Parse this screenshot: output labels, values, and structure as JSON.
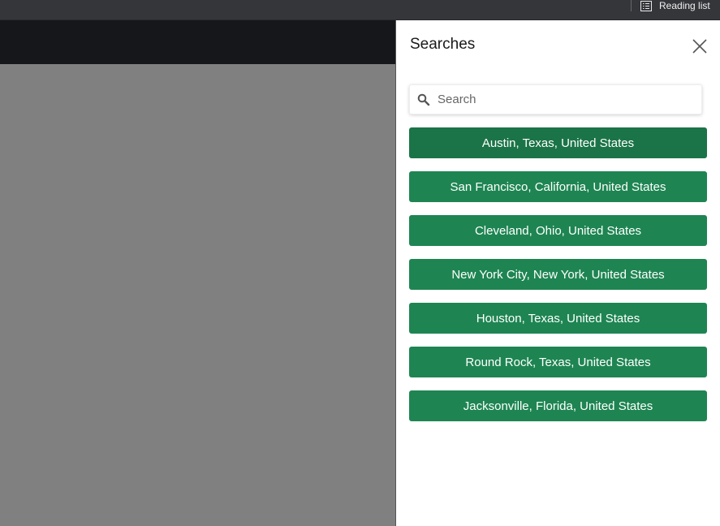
{
  "browser": {
    "reading_list_label": "Reading list"
  },
  "panel": {
    "title": "Searches",
    "search_placeholder": "Search",
    "search_value": "",
    "results": [
      {
        "label": "Austin, Texas, United States"
      },
      {
        "label": "San Francisco, California, United States"
      },
      {
        "label": "Cleveland, Ohio, United States"
      },
      {
        "label": "New York City, New York, United States"
      },
      {
        "label": "Houston, Texas, United States"
      },
      {
        "label": "Round Rock, Texas, United States"
      },
      {
        "label": "Jacksonville, Florida, United States"
      }
    ]
  },
  "colors": {
    "button_green": "#1e8552",
    "button_green_active": "#1b7447",
    "backdrop_gray": "#808080",
    "top_bar": "#35363a"
  },
  "icons": {
    "reading_list": "reading-list-icon",
    "close": "close-icon",
    "search": "search-icon"
  }
}
